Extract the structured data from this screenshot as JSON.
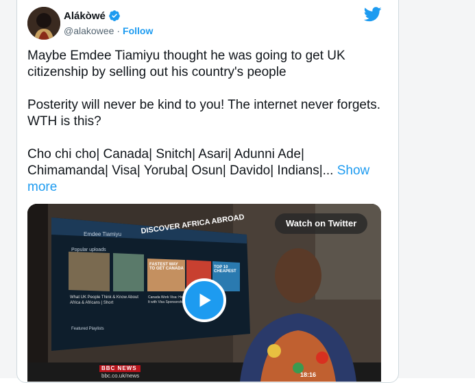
{
  "tweet": {
    "display_name": "Alákòwé",
    "handle": "@alakowee",
    "separator": "·",
    "follow_label": "Follow",
    "paragraphs": [
      "Maybe Emdee Tiamiyu thought he was going to get UK citizenship by selling out his country's people",
      "Posterity will never be kind to you! The internet never forgets. WTH is this?"
    ],
    "hashtags_line": "Cho chi cho| Canada| Snitch| Asari| Adunni Ade| Chimamanda| Visa| Yoruba| Osun| Davido| Indians|...",
    "show_more_label": "Show more"
  },
  "media": {
    "watch_label": "Watch on Twitter",
    "screen_title": "DISCOVER AFRICA ABROAD",
    "channel_name": "Emdee Tiamiyu",
    "section_label": "Popular uploads",
    "video1_title": "What UK People Think & Know About Africa & Africans | Short",
    "video2_title": "Canada Work Visa: How to Get It with Visa Sponsorship",
    "thumb2_text": "FASTEST WAY TO GET CANADA",
    "thumb3_text": "TOP 10 CHEAPEST",
    "featured_label": "Featured Playlists",
    "bbc_label": "BBC NEWS",
    "bbc_url": "bbc.co.uk/news",
    "clock": "18:16"
  },
  "icons": {
    "verified": "verified-badge-icon",
    "bird": "twitter-bird-icon",
    "play": "play-icon"
  },
  "colors": {
    "accent": "#1d9bf0",
    "text": "#0f1419",
    "muted": "#536471"
  }
}
